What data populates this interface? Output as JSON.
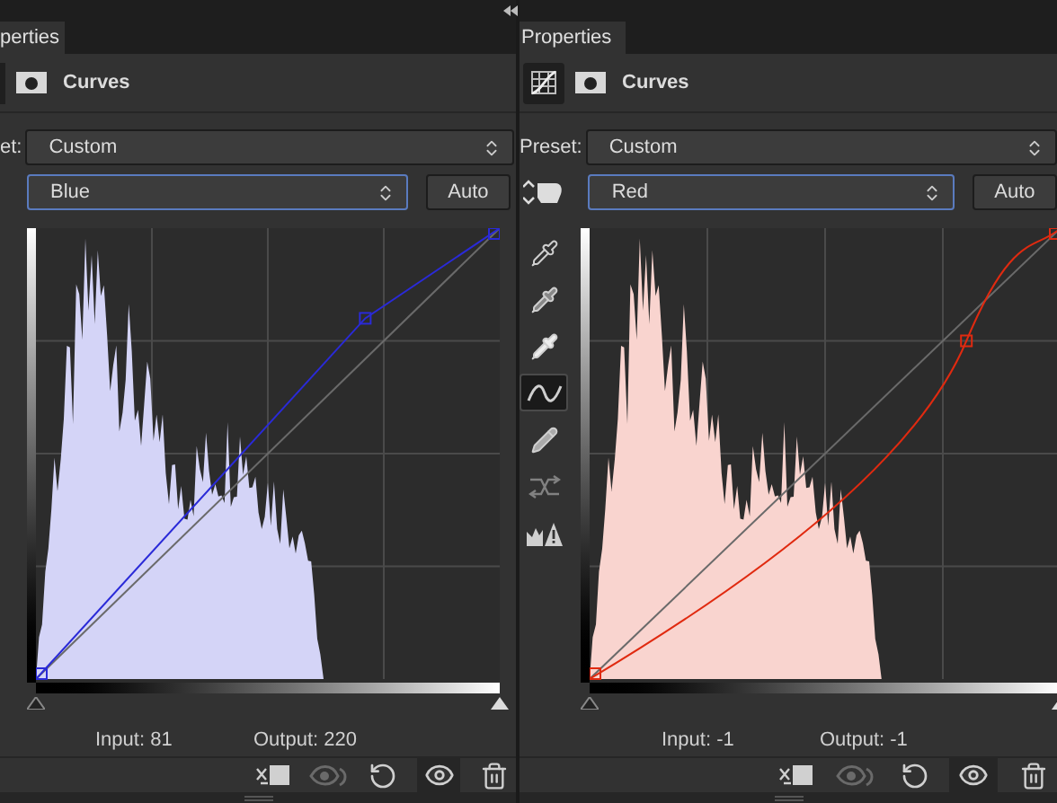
{
  "panels": [
    {
      "tab": "perties",
      "title": "Curves",
      "preset_label": "et:",
      "preset": "Custom",
      "channel": "Blue",
      "channel_focused": true,
      "auto": "Auto",
      "color": "#2a2ad8",
      "input_label": "Input:",
      "input": "81",
      "output_label": "Output:",
      "output": "220",
      "sliders": [
        {
          "kind": "shadow",
          "level": 0
        },
        {
          "kind": "highlight",
          "level": 1
        }
      ],
      "buttons": [
        {
          "kind": "clip",
          "disabled": false,
          "selected": false
        },
        {
          "kind": "view-previous",
          "disabled": true,
          "selected": false
        },
        {
          "kind": "reset",
          "disabled": false,
          "selected": false
        },
        {
          "kind": "visibility",
          "disabled": false,
          "selected": true
        },
        {
          "kind": "delete",
          "disabled": false,
          "selected": false
        }
      ]
    },
    {
      "tab": "Properties",
      "title": "Curves",
      "preset_label": "Preset:",
      "preset": "Custom",
      "channel": "Red",
      "channel_focused": true,
      "auto": "Auto",
      "color": "#e02a10",
      "input_label": "Input:",
      "input": "-1",
      "output_label": "Output:",
      "output": "-1",
      "sliders": [
        {
          "kind": "shadow",
          "level": 0
        },
        {
          "kind": "highlight",
          "level": 1
        }
      ],
      "tools": [
        {
          "kind": "black-point",
          "selected": false,
          "disabled": false
        },
        {
          "kind": "gray-point",
          "selected": false,
          "disabled": false
        },
        {
          "kind": "white-point",
          "selected": false,
          "disabled": false
        },
        {
          "kind": "curve",
          "selected": true,
          "disabled": false
        },
        {
          "kind": "pencil",
          "selected": false,
          "disabled": false
        },
        {
          "kind": "smooth",
          "selected": false,
          "disabled": true
        },
        {
          "kind": "clipping",
          "selected": false,
          "disabled": false
        }
      ],
      "buttons": [
        {
          "kind": "clip",
          "disabled": false,
          "selected": false
        },
        {
          "kind": "view-previous",
          "disabled": true,
          "selected": false
        },
        {
          "kind": "reset",
          "disabled": false,
          "selected": false
        },
        {
          "kind": "visibility",
          "disabled": false,
          "selected": true
        },
        {
          "kind": "delete",
          "disabled": false,
          "selected": false
        }
      ]
    }
  ]
}
